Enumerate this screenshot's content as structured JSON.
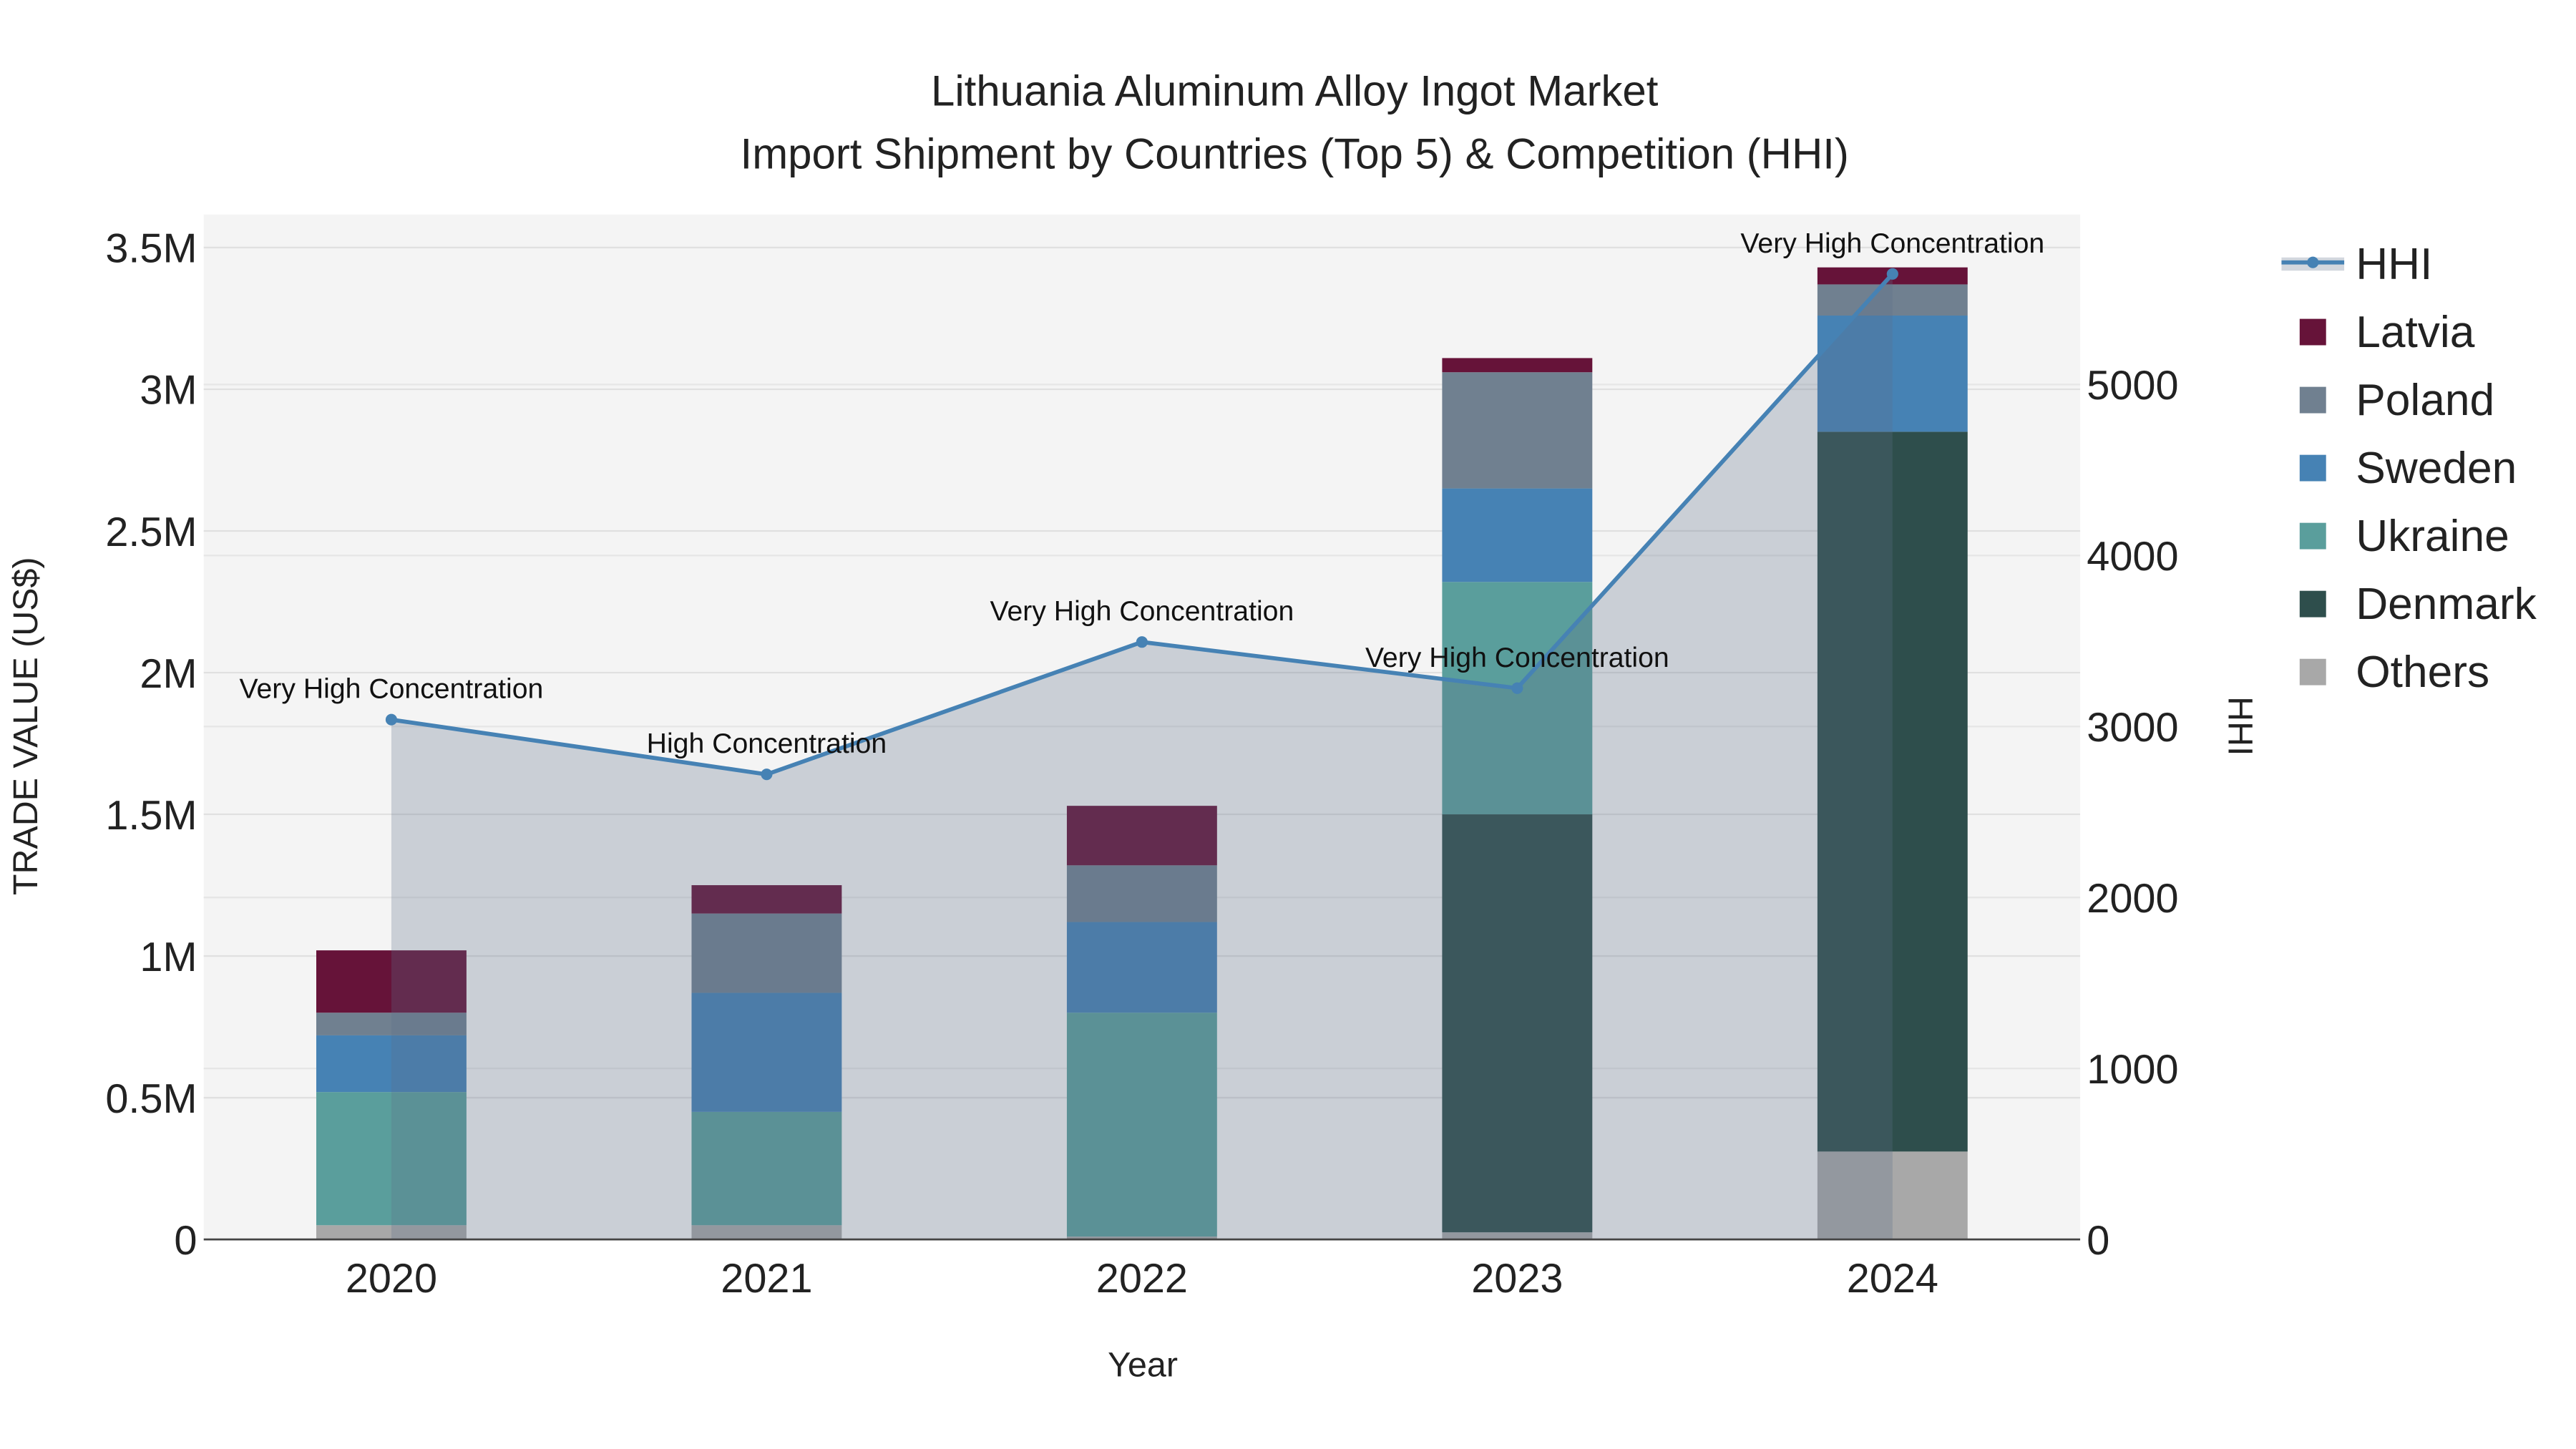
{
  "chart_data": {
    "type": "bar",
    "title": "Lithuania Aluminum Alloy Ingot Market",
    "subtitle": "Import Shipment by Countries (Top 5) & Competition (HHI)",
    "xlabel": "Year",
    "ylabel": "TRADE VALUE (US$)",
    "y2label": "HHI",
    "categories": [
      "2020",
      "2021",
      "2022",
      "2023",
      "2024"
    ],
    "ylim": [
      0,
      3600000
    ],
    "y2lim": [
      0,
      6000
    ],
    "yticks": [
      {
        "v": 0,
        "label": "0"
      },
      {
        "v": 500000,
        "label": "0.5M"
      },
      {
        "v": 1000000,
        "label": "1M"
      },
      {
        "v": 1500000,
        "label": "1.5M"
      },
      {
        "v": 2000000,
        "label": "2M"
      },
      {
        "v": 2500000,
        "label": "2.5M"
      },
      {
        "v": 3000000,
        "label": "3M"
      },
      {
        "v": 3500000,
        "label": "3.5M"
      }
    ],
    "y2ticks": [
      {
        "v": 0,
        "label": "0"
      },
      {
        "v": 1000,
        "label": "1000"
      },
      {
        "v": 2000,
        "label": "2000"
      },
      {
        "v": 3000,
        "label": "3000"
      },
      {
        "v": 4000,
        "label": "4000"
      },
      {
        "v": 5000,
        "label": "5000"
      }
    ],
    "stack_order": [
      "Others",
      "Denmark",
      "Ukraine",
      "Sweden",
      "Poland",
      "Latvia"
    ],
    "series": [
      {
        "name": "Others",
        "color": "#a8a8a8",
        "values": [
          50000,
          50000,
          10000,
          25000,
          310000
        ]
      },
      {
        "name": "Denmark",
        "color": "#2e4e4c",
        "values": [
          0,
          0,
          0,
          1475000,
          2540000
        ]
      },
      {
        "name": "Ukraine",
        "color": "#5a9e9c",
        "values": [
          470000,
          400000,
          790000,
          820000,
          0
        ]
      },
      {
        "name": "Sweden",
        "color": "#4682b4",
        "values": [
          200000,
          420000,
          320000,
          330000,
          410000
        ]
      },
      {
        "name": "Poland",
        "color": "#708090",
        "values": [
          80000,
          280000,
          200000,
          410000,
          110000
        ]
      },
      {
        "name": "Latvia",
        "color": "#661339",
        "values": [
          220000,
          100000,
          210000,
          50000,
          60000
        ]
      }
    ],
    "line": {
      "name": "HHI",
      "color": "#4682b4",
      "values": [
        3040,
        2720,
        3494,
        3224,
        5647
      ],
      "annotations": [
        "Very High Concentration",
        "High Concentration",
        "Very High Concentration",
        "Very High Concentration",
        "Very High Concentration"
      ]
    },
    "legend": {
      "placement": "right",
      "items": [
        "HHI",
        "Latvia",
        "Poland",
        "Sweden",
        "Ukraine",
        "Denmark",
        "Others"
      ]
    },
    "grid": true
  }
}
